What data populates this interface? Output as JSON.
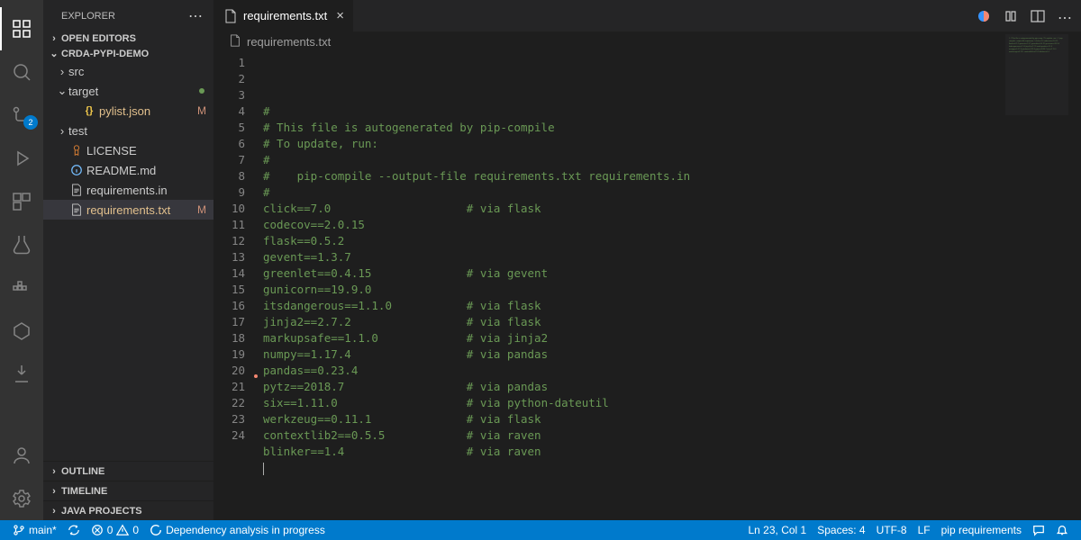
{
  "sidebar": {
    "title": "EXPLORER",
    "sections": {
      "open_editors": "OPEN EDITORS",
      "project": "CRDA-PYPI-DEMO",
      "outline": "OUTLINE",
      "timeline": "TIMELINE",
      "java": "JAVA PROJECTS"
    },
    "tree": [
      {
        "label": "src",
        "type": "folder",
        "expanded": false,
        "depth": 0
      },
      {
        "label": "target",
        "type": "folder",
        "expanded": true,
        "depth": 0,
        "decorated": true
      },
      {
        "label": "pylist.json",
        "type": "file",
        "icon": "json",
        "depth": 1,
        "status": "M"
      },
      {
        "label": "test",
        "type": "folder",
        "expanded": false,
        "depth": 0
      },
      {
        "label": "LICENSE",
        "type": "file",
        "icon": "license",
        "depth": 0
      },
      {
        "label": "README.md",
        "type": "file",
        "icon": "info",
        "depth": 0
      },
      {
        "label": "requirements.in",
        "type": "file",
        "icon": "text",
        "depth": 0
      },
      {
        "label": "requirements.txt",
        "type": "file",
        "icon": "text",
        "depth": 0,
        "status": "M",
        "selected": true
      }
    ]
  },
  "scm_badge": "2",
  "editor": {
    "tab_label": "requirements.txt",
    "breadcrumb": "requirements.txt",
    "lines": [
      {
        "t": "#",
        "cls": "c"
      },
      {
        "t": "# This file is autogenerated by pip-compile",
        "cls": "c"
      },
      {
        "t": "# To update, run:",
        "cls": "c"
      },
      {
        "t": "#",
        "cls": "c"
      },
      {
        "t": "#    pip-compile --output-file requirements.txt requirements.in",
        "cls": "c"
      },
      {
        "t": "#",
        "cls": "c"
      },
      {
        "t": "click==7.0",
        "pad": 30,
        "comment": "# via flask"
      },
      {
        "t": "codecov==2.0.15"
      },
      {
        "t": "flask==0.5.2"
      },
      {
        "t": "gevent==1.3.7"
      },
      {
        "t": "greenlet==0.4.15",
        "pad": 30,
        "comment": "# via gevent"
      },
      {
        "t": "gunicorn==19.9.0"
      },
      {
        "t": "itsdangerous==1.1.0",
        "pad": 30,
        "comment": "# via flask"
      },
      {
        "t": "jinja2==2.7.2",
        "pad": 30,
        "comment": "# via flask"
      },
      {
        "t": "markupsafe==1.1.0",
        "pad": 30,
        "comment": "# via jinja2"
      },
      {
        "t": "numpy==1.17.4",
        "pad": 30,
        "comment": "# via pandas"
      },
      {
        "t": "pandas==0.23.4"
      },
      {
        "t": "pytz==2018.7",
        "pad": 30,
        "comment": "# via pandas"
      },
      {
        "t": "six==1.11.0",
        "pad": 30,
        "comment": "# via python-dateutil"
      },
      {
        "t": "werkzeug==0.11.1",
        "pad": 30,
        "comment": "# via flask"
      },
      {
        "t": "contextlib2==0.5.5",
        "pad": 30,
        "comment": "# via raven"
      },
      {
        "t": "blinker==1.4",
        "pad": 30,
        "comment": "# via raven"
      },
      {
        "t": ""
      },
      {
        "t": ""
      }
    ]
  },
  "status": {
    "branch": "main*",
    "sync": "",
    "errors": "0",
    "warnings": "0",
    "task": "Dependency analysis in progress",
    "cursor": "Ln 23, Col 1",
    "spaces": "Spaces: 4",
    "encoding": "UTF-8",
    "eol": "LF",
    "lang": "pip requirements"
  }
}
